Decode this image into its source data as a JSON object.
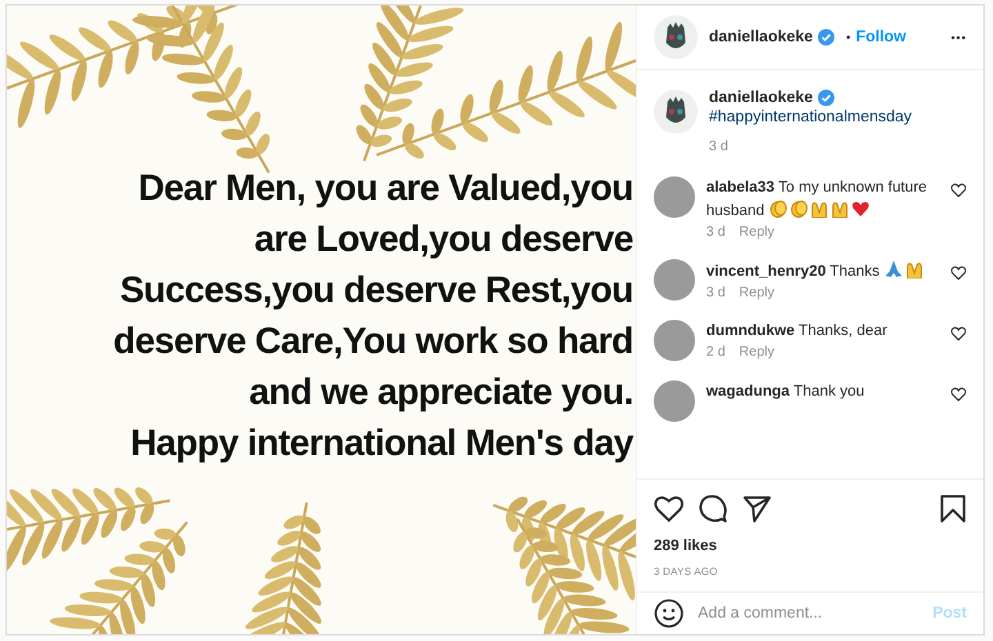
{
  "post_image": {
    "lines": [
      "Dear Men, you are Valued,you",
      "are Loved,you deserve",
      "Success,you deserve Rest,you",
      "deserve Care,You work so hard",
      "and we appreciate you.",
      "Happy international Men's day"
    ]
  },
  "header": {
    "username": "daniellaokeke",
    "verified": true,
    "separator": "•",
    "follow": "Follow",
    "more": "•••"
  },
  "caption": {
    "username": "daniellaokeke",
    "verified": true,
    "text": "#happyinternationalmensday",
    "time": "3 d"
  },
  "comments": [
    {
      "username": "alabela33",
      "text": "To my unknown future husband",
      "emojis": [
        {
          "kind": "clap"
        },
        {
          "kind": "clap"
        },
        {
          "kind": "raised-hands"
        },
        {
          "kind": "raised-hands"
        },
        {
          "kind": "heart"
        }
      ],
      "time": "3 d",
      "reply": "Reply"
    },
    {
      "username": "vincent_henry20",
      "text": "Thanks",
      "emojis": [
        {
          "kind": "pray"
        },
        {
          "kind": "raised-hands"
        }
      ],
      "time": "3 d",
      "reply": "Reply"
    },
    {
      "username": "dumndukwe",
      "text": "Thanks, dear",
      "time": "2 d",
      "reply": "Reply"
    },
    {
      "username": "wagadunga",
      "text": "Thank you"
    }
  ],
  "likes": "289 likes",
  "date": "3 DAYS AGO",
  "comment_field": {
    "placeholder": "Add a comment...",
    "post": "Post"
  }
}
